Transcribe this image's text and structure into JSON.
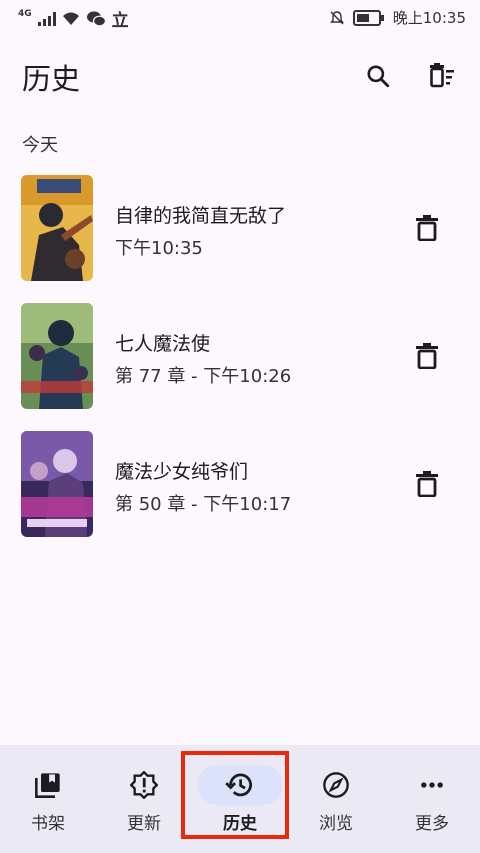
{
  "status": {
    "network": "4G",
    "chinese_char": "立",
    "time": "晚上10:35"
  },
  "header": {
    "title": "历史"
  },
  "section": {
    "today": "今天"
  },
  "history": [
    {
      "title": "自律的我简直无敌了",
      "subtitle": "下午10:35"
    },
    {
      "title": "七人魔法使",
      "subtitle": "第 77 章 - 下午10:26"
    },
    {
      "title": "魔法少女纯爷们",
      "subtitle": "第 50 章 - 下午10:17"
    }
  ],
  "nav": {
    "items": [
      {
        "label": "书架",
        "icon": "library-icon"
      },
      {
        "label": "更新",
        "icon": "updates-icon"
      },
      {
        "label": "历史",
        "icon": "history-icon"
      },
      {
        "label": "浏览",
        "icon": "compass-icon"
      },
      {
        "label": "更多",
        "icon": "more-icon"
      }
    ],
    "active_index": 2
  },
  "colors": {
    "background": "#fcf8fe",
    "nav_background": "#ebe9f4",
    "active_pill": "#dce2f9",
    "highlight_border": "#e8290b"
  }
}
